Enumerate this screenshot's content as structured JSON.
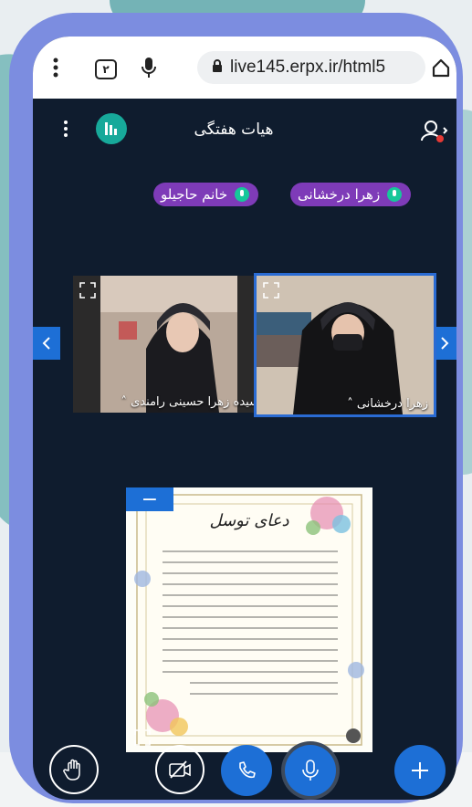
{
  "browser": {
    "tab_count": "۲",
    "url": "live145.erpx.ir/html5"
  },
  "app": {
    "title": "هیات هفتگی"
  },
  "talking": [
    {
      "name": "زهرا درخشانی"
    },
    {
      "name": "خانم حاجیلو"
    }
  ],
  "videos": [
    {
      "name": "سیده زهرا حسینی رامندی"
    },
    {
      "name": "زهرا درخشانی"
    }
  ],
  "presentation": {
    "title": "دعای توسل"
  },
  "colors": {
    "frame": "#7c8de0",
    "screen": "#0f1c2e",
    "accent": "#1d6fd6",
    "chip": "#7e3bb8",
    "talking": "#16c79a"
  }
}
